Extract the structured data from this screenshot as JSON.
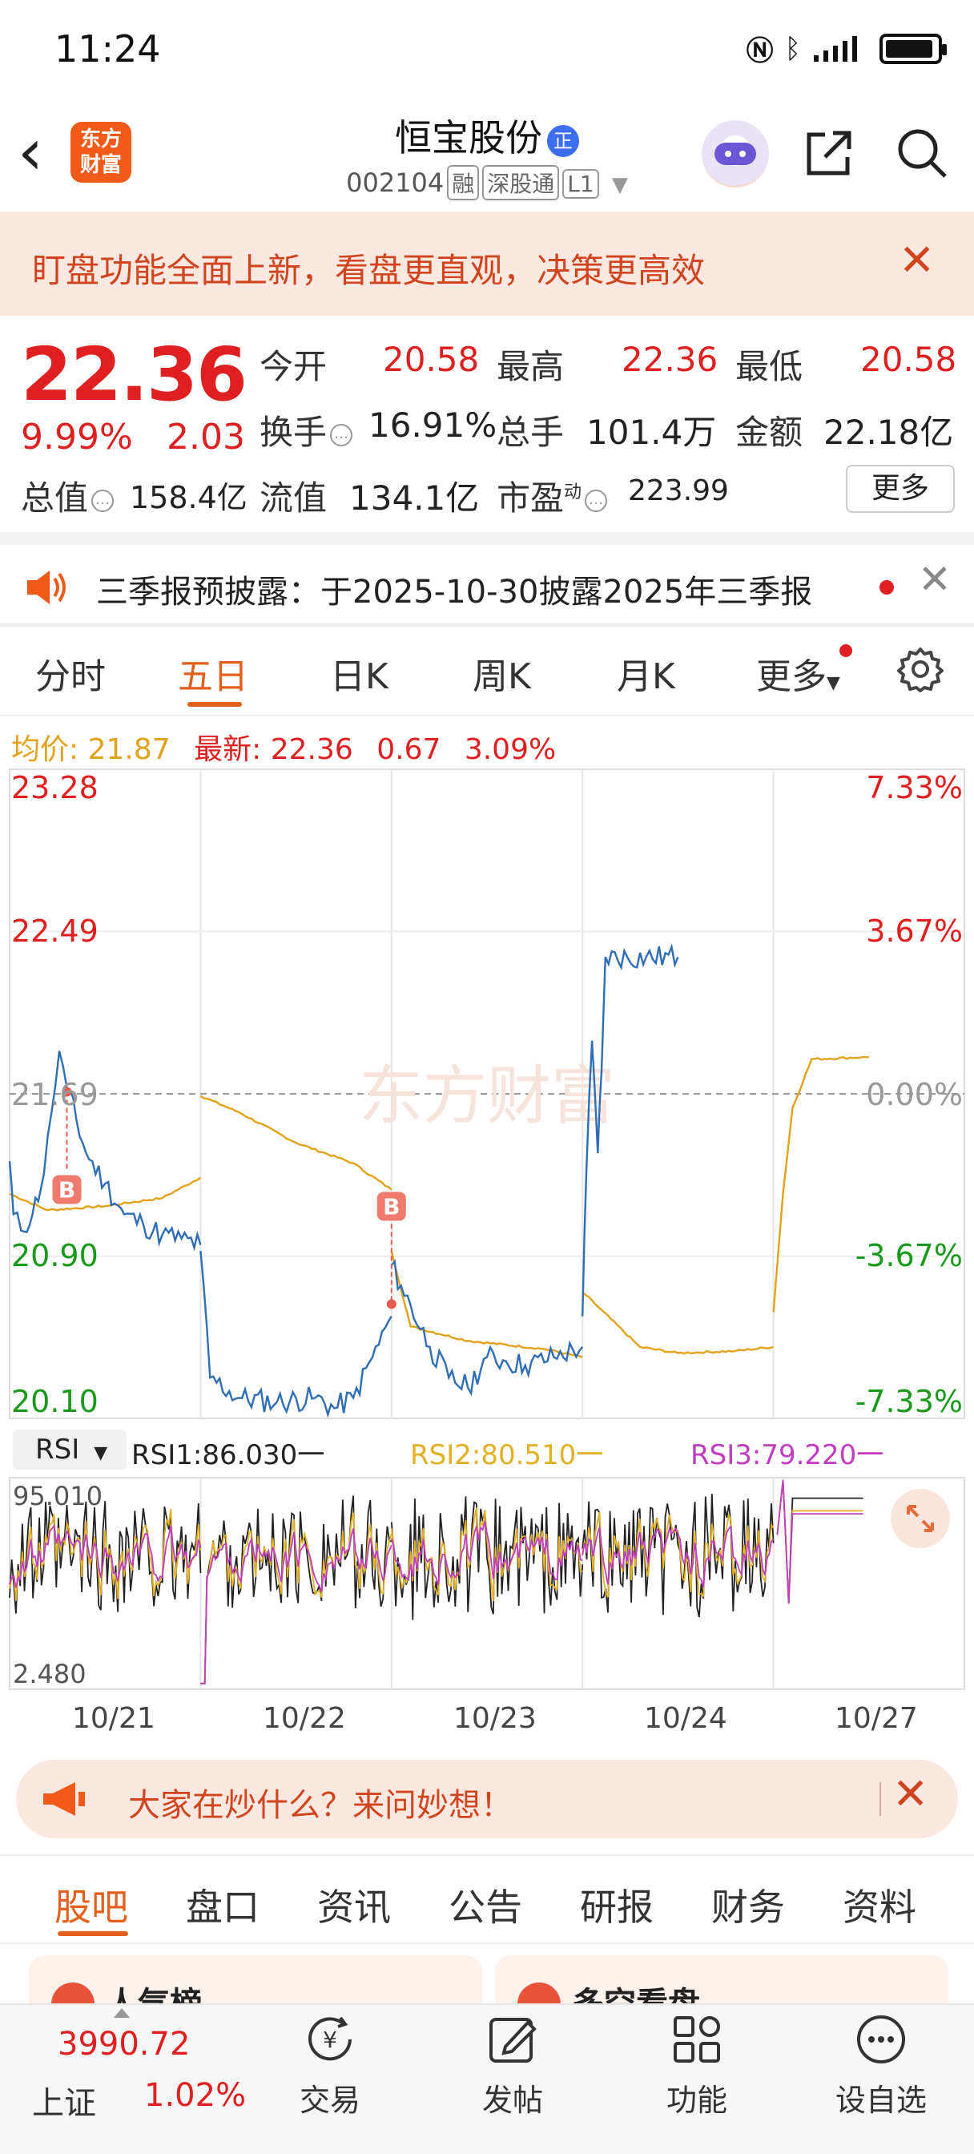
{
  "status": {
    "time": "11:24"
  },
  "header": {
    "logo_line1": "东方",
    "logo_line2": "财富",
    "title": "恒宝股份",
    "title_badge": "正",
    "code": "002104",
    "tag1": "融",
    "tag2": "深股通",
    "tag3": "L1"
  },
  "banner": {
    "text": "盯盘功能全面上新，看盘更直观，决策更高效"
  },
  "quote": {
    "price": "22.36",
    "pct": "9.99%",
    "change": "2.03",
    "stats": [
      {
        "label": "今开",
        "value": "20.58"
      },
      {
        "label": "最高",
        "value": "22.36"
      },
      {
        "label": "最低",
        "value": "20.58"
      },
      {
        "label": "换手",
        "value": "16.91%"
      },
      {
        "label": "总手",
        "value": "101.4万"
      },
      {
        "label": "金额",
        "value": "22.18亿"
      },
      {
        "label": "总值",
        "value": "158.4亿"
      },
      {
        "label": "流值",
        "value": "134.1亿"
      },
      {
        "label": "市盈",
        "value": "223.99"
      }
    ],
    "pe_sup": "动",
    "more": "更多"
  },
  "notice": {
    "text": "三季报预披露：于2025-10-30披露2025年三季报"
  },
  "tabs": [
    "分时",
    "五日",
    "日K",
    "周K",
    "月K",
    "更多"
  ],
  "info": {
    "avg_label": "均价:",
    "avg_value": "21.87",
    "last_label": "最新:",
    "last_value": "22.36",
    "change": "0.67",
    "pct": "3.09%"
  },
  "chart_data": [
    {
      "type": "line",
      "watermark": "东方财富",
      "y_left_ticks": [
        "23.28",
        "22.49",
        "21.69",
        "20.90",
        "20.10"
      ],
      "y_right_ticks": [
        "7.33%",
        "3.67%",
        "0.00%",
        "-3.67%",
        "-7.33%"
      ],
      "ylim": [
        20.1,
        23.28
      ],
      "base_price": 21.69,
      "days": [
        "10/21",
        "10/22",
        "10/23",
        "10/24",
        "10/27"
      ],
      "markers": [
        {
          "label": "B",
          "day": "10/21"
        },
        {
          "label": "B",
          "day": "10/23"
        }
      ],
      "series": [
        {
          "name": "price",
          "color": "#2f6db5",
          "keypoints": [
            [
              0.0,
              21.36
            ],
            [
              0.02,
              21.1
            ],
            [
              0.06,
              21.02
            ],
            [
              0.12,
              21.1
            ],
            [
              0.18,
              21.3
            ],
            [
              0.22,
              21.6
            ],
            [
              0.26,
              21.9
            ],
            [
              0.3,
              21.72
            ],
            [
              0.4,
              21.4
            ],
            [
              0.5,
              21.25
            ],
            [
              0.6,
              21.1
            ],
            [
              0.7,
              21.05
            ],
            [
              0.8,
              21.0
            ],
            [
              0.9,
              20.98
            ],
            [
              1.0,
              20.95
            ],
            [
              1.0,
              20.92
            ],
            [
              1.05,
              20.3
            ],
            [
              1.2,
              20.2
            ],
            [
              1.4,
              20.18
            ],
            [
              1.6,
              20.2
            ],
            [
              1.7,
              20.15
            ],
            [
              1.8,
              20.2
            ],
            [
              1.9,
              20.4
            ],
            [
              2.0,
              20.6
            ],
            [
              2.0,
              20.85
            ],
            [
              2.05,
              20.75
            ],
            [
              2.2,
              20.45
            ],
            [
              2.3,
              20.3
            ],
            [
              2.4,
              20.25
            ],
            [
              2.5,
              20.4
            ],
            [
              2.6,
              20.38
            ],
            [
              2.7,
              20.36
            ],
            [
              2.85,
              20.4
            ],
            [
              3.0,
              20.45
            ],
            [
              3.0,
              20.6
            ],
            [
              3.02,
              21.3
            ],
            [
              3.05,
              21.95
            ],
            [
              3.08,
              21.4
            ],
            [
              3.1,
              21.8
            ],
            [
              3.12,
              22.36
            ],
            [
              3.5,
              22.36
            ]
          ]
        },
        {
          "name": "avg",
          "color": "#e2a21a",
          "keypoints": [
            [
              0.0,
              21.2
            ],
            [
              0.2,
              21.12
            ],
            [
              0.5,
              21.14
            ],
            [
              0.8,
              21.18
            ],
            [
              1.0,
              21.28
            ],
            [
              1.0,
              21.68
            ],
            [
              1.2,
              21.6
            ],
            [
              1.5,
              21.45
            ],
            [
              1.8,
              21.35
            ],
            [
              2.0,
              21.22
            ],
            [
              2.0,
              20.92
            ],
            [
              2.1,
              20.55
            ],
            [
              2.4,
              20.48
            ],
            [
              2.8,
              20.44
            ],
            [
              3.0,
              20.4
            ],
            [
              3.0,
              20.72
            ],
            [
              3.3,
              20.45
            ],
            [
              3.5,
              20.42
            ],
            [
              3.8,
              20.43
            ],
            [
              4.0,
              20.45
            ],
            [
              4.0,
              20.62
            ],
            [
              4.05,
              21.2
            ],
            [
              4.1,
              21.62
            ],
            [
              4.2,
              21.86
            ],
            [
              4.5,
              21.87
            ]
          ]
        }
      ]
    },
    {
      "type": "line",
      "indicator": "RSI",
      "y_ticks": [
        "95.010",
        "2.480"
      ],
      "ylim": [
        2.48,
        95.01
      ],
      "series": [
        {
          "name": "RSI1",
          "value": "86.030",
          "color": "#222222"
        },
        {
          "name": "RSI2",
          "value": "80.510",
          "color": "#e2b021"
        },
        {
          "name": "RSI3",
          "value": "79.220",
          "color": "#c03dc0"
        }
      ]
    }
  ],
  "rsi": {
    "selector": "RSI",
    "rsi1": "RSI1:86.030一",
    "rsi2": "RSI2:80.510一",
    "rsi3": "RSI3:79.220一"
  },
  "ask": {
    "text": "大家在炒什么？来问妙想！"
  },
  "bottom_tabs": [
    "股吧",
    "盘口",
    "资讯",
    "公告",
    "研报",
    "财务",
    "资料"
  ],
  "cards": [
    {
      "icon": "人气榜",
      "title": "人气榜"
    },
    {
      "icon": "多空看盘",
      "title": "多空看盘"
    }
  ],
  "nav": {
    "index_value": "3990.72",
    "index_name": "上证",
    "index_pct": "1.02%",
    "items": [
      "交易",
      "发帖",
      "功能",
      "设自选"
    ]
  },
  "colors": {
    "accent": "#e35f1c",
    "up": "#e02020",
    "down": "#1a9a1a",
    "price_line": "#2f6db5",
    "avg_line": "#e2a21a"
  }
}
